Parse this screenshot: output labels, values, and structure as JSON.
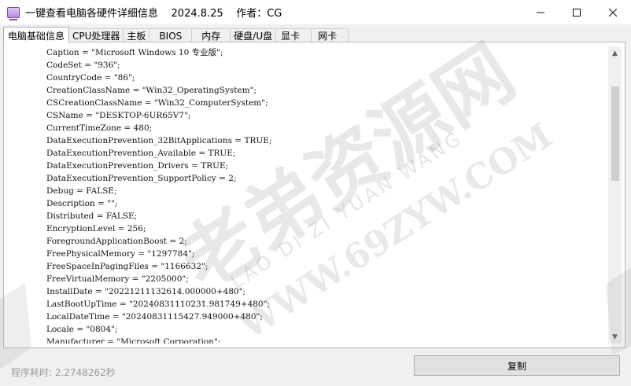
{
  "window": {
    "title": "一键查看电脑各硬件详细信息    2024.8.25    作者：CG",
    "icon": "monitor-icon"
  },
  "tabs": [
    {
      "label": "电脑基础信息",
      "active": true
    },
    {
      "label": "CPU处理器",
      "active": false
    },
    {
      "label": "主板",
      "active": false
    },
    {
      "label": "BIOS",
      "active": false
    },
    {
      "label": "内存",
      "active": false
    },
    {
      "label": "硬盘/U盘",
      "active": false
    },
    {
      "label": "显卡",
      "active": false
    },
    {
      "label": "网卡",
      "active": false
    }
  ],
  "content": {
    "lines": [
      "Caption = \"Microsoft Windows 10 专业版\";",
      "CodeSet = \"936\";",
      "CountryCode = \"86\";",
      "CreationClassName = \"Win32_OperatingSystem\";",
      "CSCreationClassName = \"Win32_ComputerSystem\";",
      "CSName = \"DESKTOP-6UR65V7\";",
      "CurrentTimeZone = 480;",
      "DataExecutionPrevention_32BitApplications = TRUE;",
      "DataExecutionPrevention_Available = TRUE;",
      "DataExecutionPrevention_Drivers = TRUE;",
      "DataExecutionPrevention_SupportPolicy = 2;",
      "Debug = FALSE;",
      "Description = \"\";",
      "Distributed = FALSE;",
      "EncryptionLevel = 256;",
      "ForegroundApplicationBoost = 2;",
      "FreePhysicalMemory = \"1297784\";",
      "FreeSpaceInPagingFiles = \"1166632\";",
      "FreeVirtualMemory = \"2205000\";",
      "InstallDate = \"20221211132614.000000+480\";",
      "LastBootUpTime = \"20240831110231.981749+480\";",
      "LocalDateTime = \"20240831115427.949000+480\";",
      "Locale = \"0804\";",
      "Manufacturer = \"Microsoft Corporation\";"
    ]
  },
  "watermark": {
    "line1": "老弟资源网",
    "line2": "LAO DI ZI YUAN WANG",
    "line3": "WWW.69ZYW.COM"
  },
  "status": {
    "elapsed": "程序耗时: 2.2748262秒"
  },
  "buttons": {
    "copy": "复制"
  },
  "scroll": {
    "position_fraction": 0.15,
    "visible_fraction": 0.35
  }
}
